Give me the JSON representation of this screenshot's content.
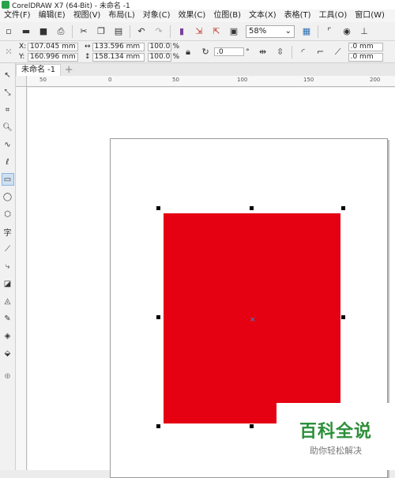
{
  "app": {
    "title": "CorelDRAW X7 (64-Bit) - 未命名 -1"
  },
  "menu": [
    "文件(F)",
    "编辑(E)",
    "视图(V)",
    "布局(L)",
    "对象(C)",
    "效果(C)",
    "位图(B)",
    "文本(X)",
    "表格(T)",
    "工具(O)",
    "窗口(W)"
  ],
  "toolbar": {
    "zoom": "58%"
  },
  "props": {
    "x": "107.045 mm",
    "y": "160.996 mm",
    "w": "133.596 mm",
    "h": "158.134 mm",
    "scale_w": "100.0",
    "scale_h": "100.0",
    "pct": "%",
    "rotation": ".0",
    "deg": "°",
    "corner1": ".0 mm",
    "corner2": ".0 mm",
    "label_x": "X:",
    "label_y": "Y:"
  },
  "tab": {
    "name": "未命名 -1",
    "add": "+"
  },
  "ruler": {
    "h_ticks": [
      "50",
      "0",
      "50",
      "100",
      "150",
      "200"
    ]
  },
  "colors": {
    "fill": "#e50012"
  },
  "watermark": {
    "title": "百科全说",
    "subtitle": "助你轻松解决"
  }
}
